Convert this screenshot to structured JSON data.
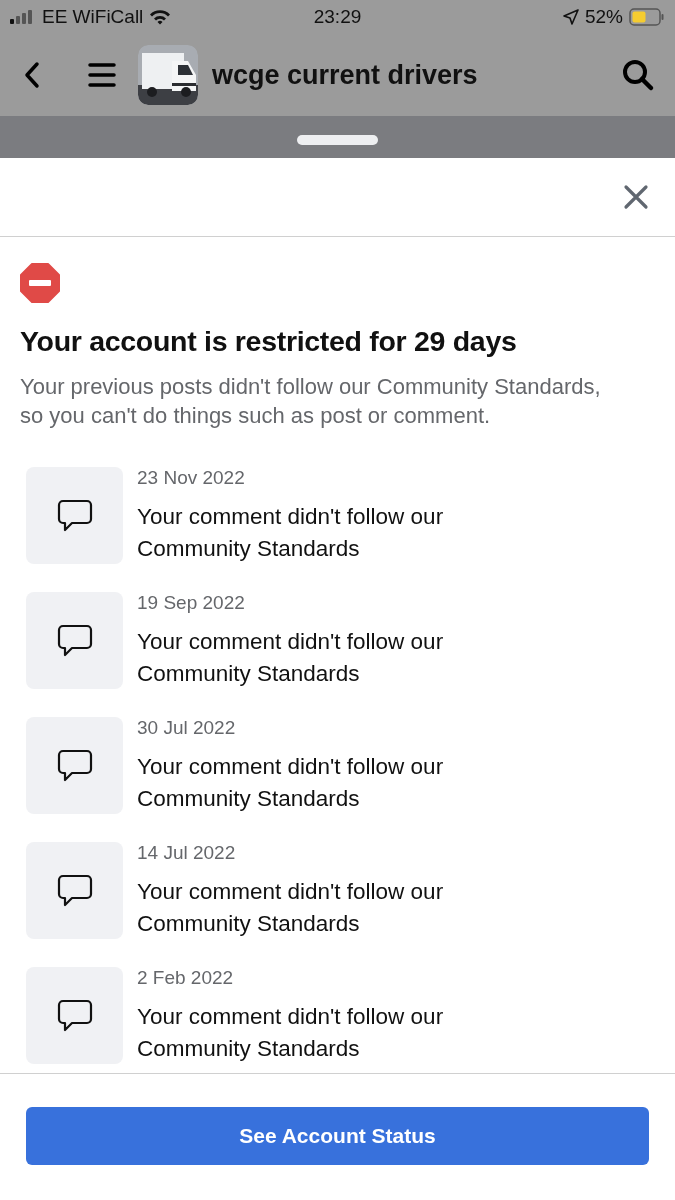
{
  "status_bar": {
    "carrier": "EE WiFiCall",
    "time": "23:29",
    "battery": "52%"
  },
  "header": {
    "title": "wcge current drivers"
  },
  "sheet": {
    "title": "Your account is restricted for 29 days",
    "description": "Your previous posts didn't follow our Community Standards, so you can't do things such as post or comment.",
    "items": [
      {
        "date": "23 Nov 2022",
        "text": "Your comment didn't follow our Community Standards"
      },
      {
        "date": "19 Sep 2022",
        "text": "Your comment didn't follow our Community Standards"
      },
      {
        "date": "30 Jul 2022",
        "text": "Your comment didn't follow our Community Standards"
      },
      {
        "date": "14 Jul 2022",
        "text": "Your comment didn't follow our Community Standards"
      },
      {
        "date": "2 Feb 2022",
        "text": "Your comment didn't follow our Community Standards"
      }
    ],
    "button": "See Account Status"
  }
}
